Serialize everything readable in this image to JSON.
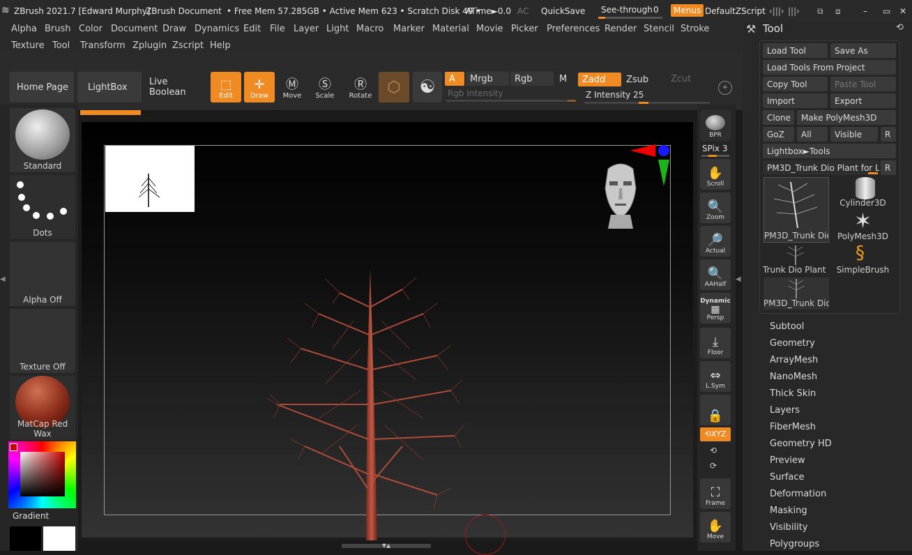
{
  "titlebar": {
    "app": "ZBrush 2021.7 [Edward Murphy]",
    "doc": "ZBrush Document",
    "mem": "• Free Mem 57.285GB • Active Mem 623 • Scratch Disk 49 •",
    "atime": "ATime►0.0",
    "ac": "AC",
    "quicksave": "QuickSave",
    "seethrough": "See-through",
    "seethrough_val": "0",
    "menus": "Menus",
    "script": "DefaultZScript"
  },
  "menu": [
    "Alpha",
    "Brush",
    "Color",
    "Document",
    "Draw",
    "Dynamics",
    "Edit",
    "File",
    "Layer",
    "Light",
    "Macro",
    "Marker",
    "Material",
    "Movie",
    "Picker",
    "Preferences",
    "Render",
    "Stencil",
    "Stroke"
  ],
  "menu2": [
    "Texture",
    "Tool",
    "Transform",
    "Zplugin",
    "Zscript",
    "Help"
  ],
  "shelf": {
    "home": "Home Page",
    "lightbox": "LightBox",
    "liveboolean": "Live Boolean",
    "edit": "Edit",
    "draw": "Draw",
    "move": "Move",
    "scale": "Scale",
    "rotate": "Rotate",
    "a": "A",
    "mrgb": "Mrgb",
    "rgb": "Rgb",
    "m": "M",
    "zadd": "Zadd",
    "zsub": "Zsub",
    "zcut": "Zcut",
    "rgb_intensity": "Rgb Intensity",
    "z_intensity": "Z Intensity 25"
  },
  "left": {
    "brush": "Standard",
    "stroke": "Dots",
    "alpha": "Alpha Off",
    "texture": "Texture Off",
    "material": "MatCap Red Wax",
    "gradient": "Gradient"
  },
  "right": {
    "bpr": "BPR",
    "spix": "SPix 3",
    "scroll": "Scroll",
    "zoom": "Zoom",
    "actual": "Actual",
    "aahalf": "AAHalf",
    "dynamic": "Dynamic",
    "persp": "Persp",
    "floor": "Floor",
    "lsym": "L.Sym",
    "xyz": "⟲XYZ",
    "frame": "Frame",
    "move": "Move"
  },
  "tool": {
    "title": "Tool",
    "load_tool": "Load Tool",
    "save_as": "Save As",
    "load_project": "Load Tools From Project",
    "copy_tool": "Copy Tool",
    "paste_tool": "Paste Tool",
    "import": "Import",
    "export": "Export",
    "clone": "Clone",
    "make_polymesh": "Make PolyMesh3D",
    "goz": "GoZ",
    "all": "All",
    "visible": "Visible",
    "r": "R",
    "lightbox_tools": "Lightbox►Tools",
    "current": "PM3D_Trunk Dio Plant for Le",
    "thumbs": [
      "PM3D_Trunk Dio",
      "Cylinder3D",
      "PolyMesh3D",
      "Trunk Dio Plant f",
      "SimpleBrush",
      "PM3D_Trunk Dio"
    ],
    "subpalettes": [
      "Subtool",
      "Geometry",
      "ArrayMesh",
      "NanoMesh",
      "Thick Skin",
      "Layers",
      "FiberMesh",
      "Geometry HD",
      "Preview",
      "Surface",
      "Deformation",
      "Masking",
      "Visibility",
      "Polygroups"
    ]
  },
  "colors": {
    "accent": "#f08a23",
    "bg": "#2a2a2a",
    "tree": "#b5503f"
  }
}
